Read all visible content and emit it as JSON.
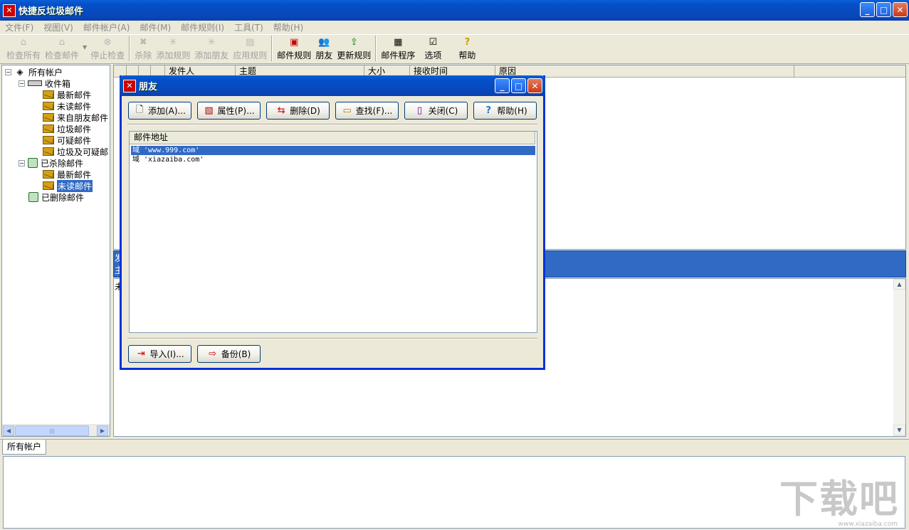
{
  "app": {
    "title": "快捷反垃圾邮件"
  },
  "menu": [
    "文件(F)",
    "视图(V)",
    "邮件帐户(A)",
    "邮件(M)",
    "邮件规则(I)",
    "工具(T)",
    "帮助(H)"
  ],
  "toolbar": {
    "check_all": "检查所有",
    "check_mail": "检查邮件",
    "stop_check": "停止检查",
    "kill": "杀除",
    "add_rule": "添加规则",
    "add_friend": "添加朋友",
    "apply_rule": "应用规则",
    "mail_rules": "邮件规则",
    "friends": "朋友",
    "update_rules": "更新规则",
    "mail_program": "邮件程序",
    "options": "选项",
    "help": "帮助"
  },
  "tree": {
    "root": "所有帐户",
    "inbox": "收件箱",
    "inbox_items": [
      "最新邮件",
      "未读邮件",
      "来自朋友邮件",
      "垃圾邮件",
      "可疑邮件",
      "垃圾及可疑邮"
    ],
    "killed": "已杀除邮件",
    "killed_items": [
      "最新邮件",
      "未读邮件"
    ],
    "deleted": "已删除邮件"
  },
  "message_list": {
    "columns": [
      "发件人",
      "主题",
      "大小",
      "接收时间",
      "原因"
    ]
  },
  "preview": {
    "line1": "发",
    "line2": "主",
    "body": "未"
  },
  "bottom": {
    "tab": "所有帐户",
    "watermark": "下载吧",
    "watermark_sub": "www.xiazaiba.com"
  },
  "dialog": {
    "title": "朋友",
    "buttons": {
      "add": "添加(A)...",
      "properties": "属性(P)...",
      "delete": "删除(D)",
      "find": "查找(F)...",
      "close": "关闭(C)",
      "help": "帮助(H)",
      "import": "导入(I)...",
      "backup": "备份(B)"
    },
    "list_header": "邮件地址",
    "addresses": [
      "域 'www.999.com'",
      "域 'xiazaiba.com'"
    ]
  }
}
